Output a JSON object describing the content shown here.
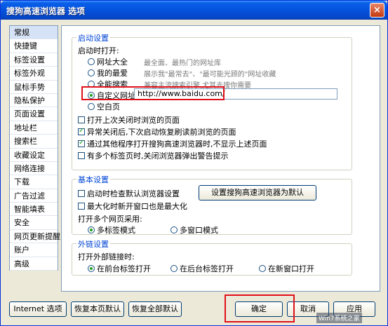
{
  "window": {
    "title": "搜狗高速浏览器 选项",
    "close_label": "×"
  },
  "sidebar": {
    "items": [
      "常规",
      "快捷键",
      "标签设置",
      "标签外观",
      "鼠标手势",
      "隐私保护",
      "页面设置",
      "地址栏",
      "搜索栏",
      "收藏设定",
      "网络连接",
      "下载",
      "广告过滤",
      "智能填表",
      "安全",
      "网页更新提醒",
      "账户",
      "高级"
    ],
    "active_index": 0
  },
  "startup": {
    "title": "启动设置",
    "label": "启动时打开:",
    "options": [
      {
        "label": "网址大全",
        "desc": "最全面、最热门的网址库",
        "selected": false
      },
      {
        "label": "我的最爱",
        "desc": "展示我\"最常去\"、\"最可能光顾的\"网址收藏",
        "selected": false
      },
      {
        "label": "全能搜索",
        "desc": "兼容主流搜索引擎,尤其去搜你需要",
        "selected": false
      },
      {
        "label": "自定义网址",
        "desc": "",
        "selected": true
      },
      {
        "label": "空白页",
        "desc": "",
        "selected": false
      }
    ],
    "custom_url": "http://www.baidu.com/",
    "checks": [
      {
        "label": "打开上次关闭时浏览的页面",
        "checked": false
      },
      {
        "label": "异常关闭后,下次启动恢复刷读前浏览的页面",
        "checked": true
      },
      {
        "label": "通过其他程序打开搜狗高速浏览器时,不显示上述页面",
        "checked": true
      },
      {
        "label": "有多个标签页时,关闭浏览器弹出警告提示",
        "checked": false
      }
    ]
  },
  "basic": {
    "title": "基本设置",
    "check_default": "启动时检查默认浏览器设置",
    "set_default_button": "设置搜狗高速浏览器为默认",
    "maximize": "最大化时新开窗口也是最大化",
    "multi_label": "打开多个网页采用:",
    "multi_tab": "多标签模式",
    "multi_window": "多窗口模式"
  },
  "external": {
    "title": "外链设置",
    "label": "打开外部链接时:",
    "opt1": "在前台标签打开",
    "opt2": "在后台标签打开",
    "opt3": "在新窗口打开"
  },
  "footer": {
    "internet_options": "Internet 选项",
    "restore_page": "恢复本页默认",
    "restore_all": "恢复全部默认",
    "ok": "确定",
    "cancel": "取消",
    "apply": "应用"
  },
  "watermark": "Win7系统之家"
}
